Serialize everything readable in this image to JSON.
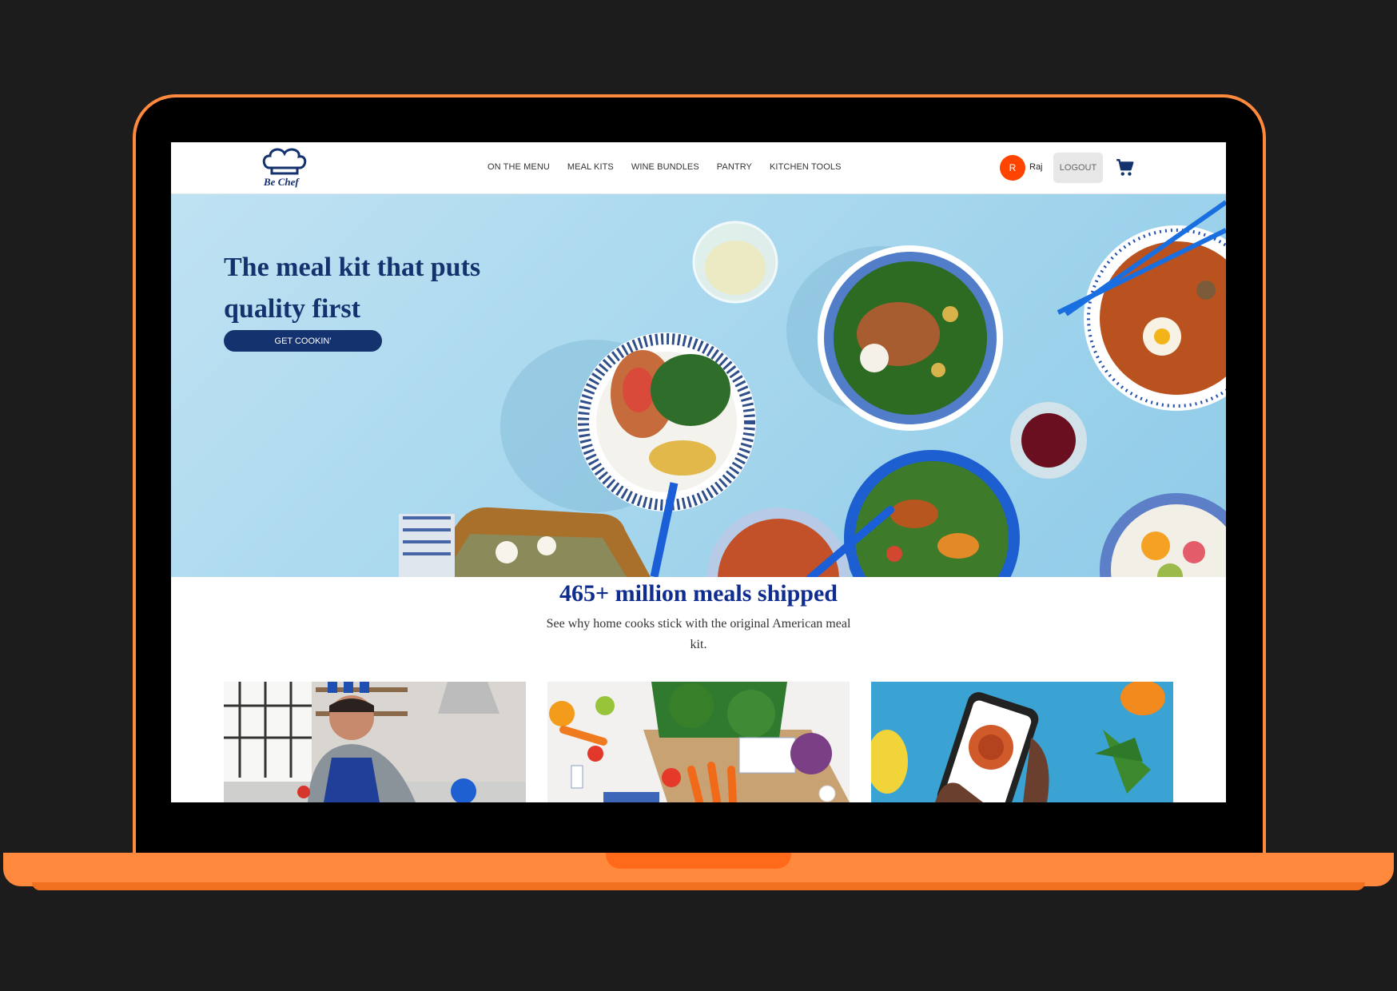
{
  "brand": {
    "logo_text": "Be Chef"
  },
  "nav": {
    "items": [
      {
        "label": "ON THE MENU"
      },
      {
        "label": "MEAL KITS"
      },
      {
        "label": "WINE BUNDLES"
      },
      {
        "label": "PANTRY"
      },
      {
        "label": "KITCHEN TOOLS"
      }
    ]
  },
  "user": {
    "initial": "R",
    "name": "Raj",
    "logout_label": "LOGOUT"
  },
  "icons": {
    "cart": "cart-icon",
    "logo": "chef-hat-icon"
  },
  "hero": {
    "title": "The meal kit that puts quality first",
    "cta_label": "GET COOKIN'"
  },
  "stats": {
    "title": "465+ million meals shipped",
    "subtitle": "See why home cooks stick with the original American meal kit."
  },
  "colors": {
    "brand_navy": "#14326e",
    "accent_orange": "#ff4400",
    "frame_orange": "#ff8a3d",
    "stats_blue": "#0f2c8f"
  }
}
